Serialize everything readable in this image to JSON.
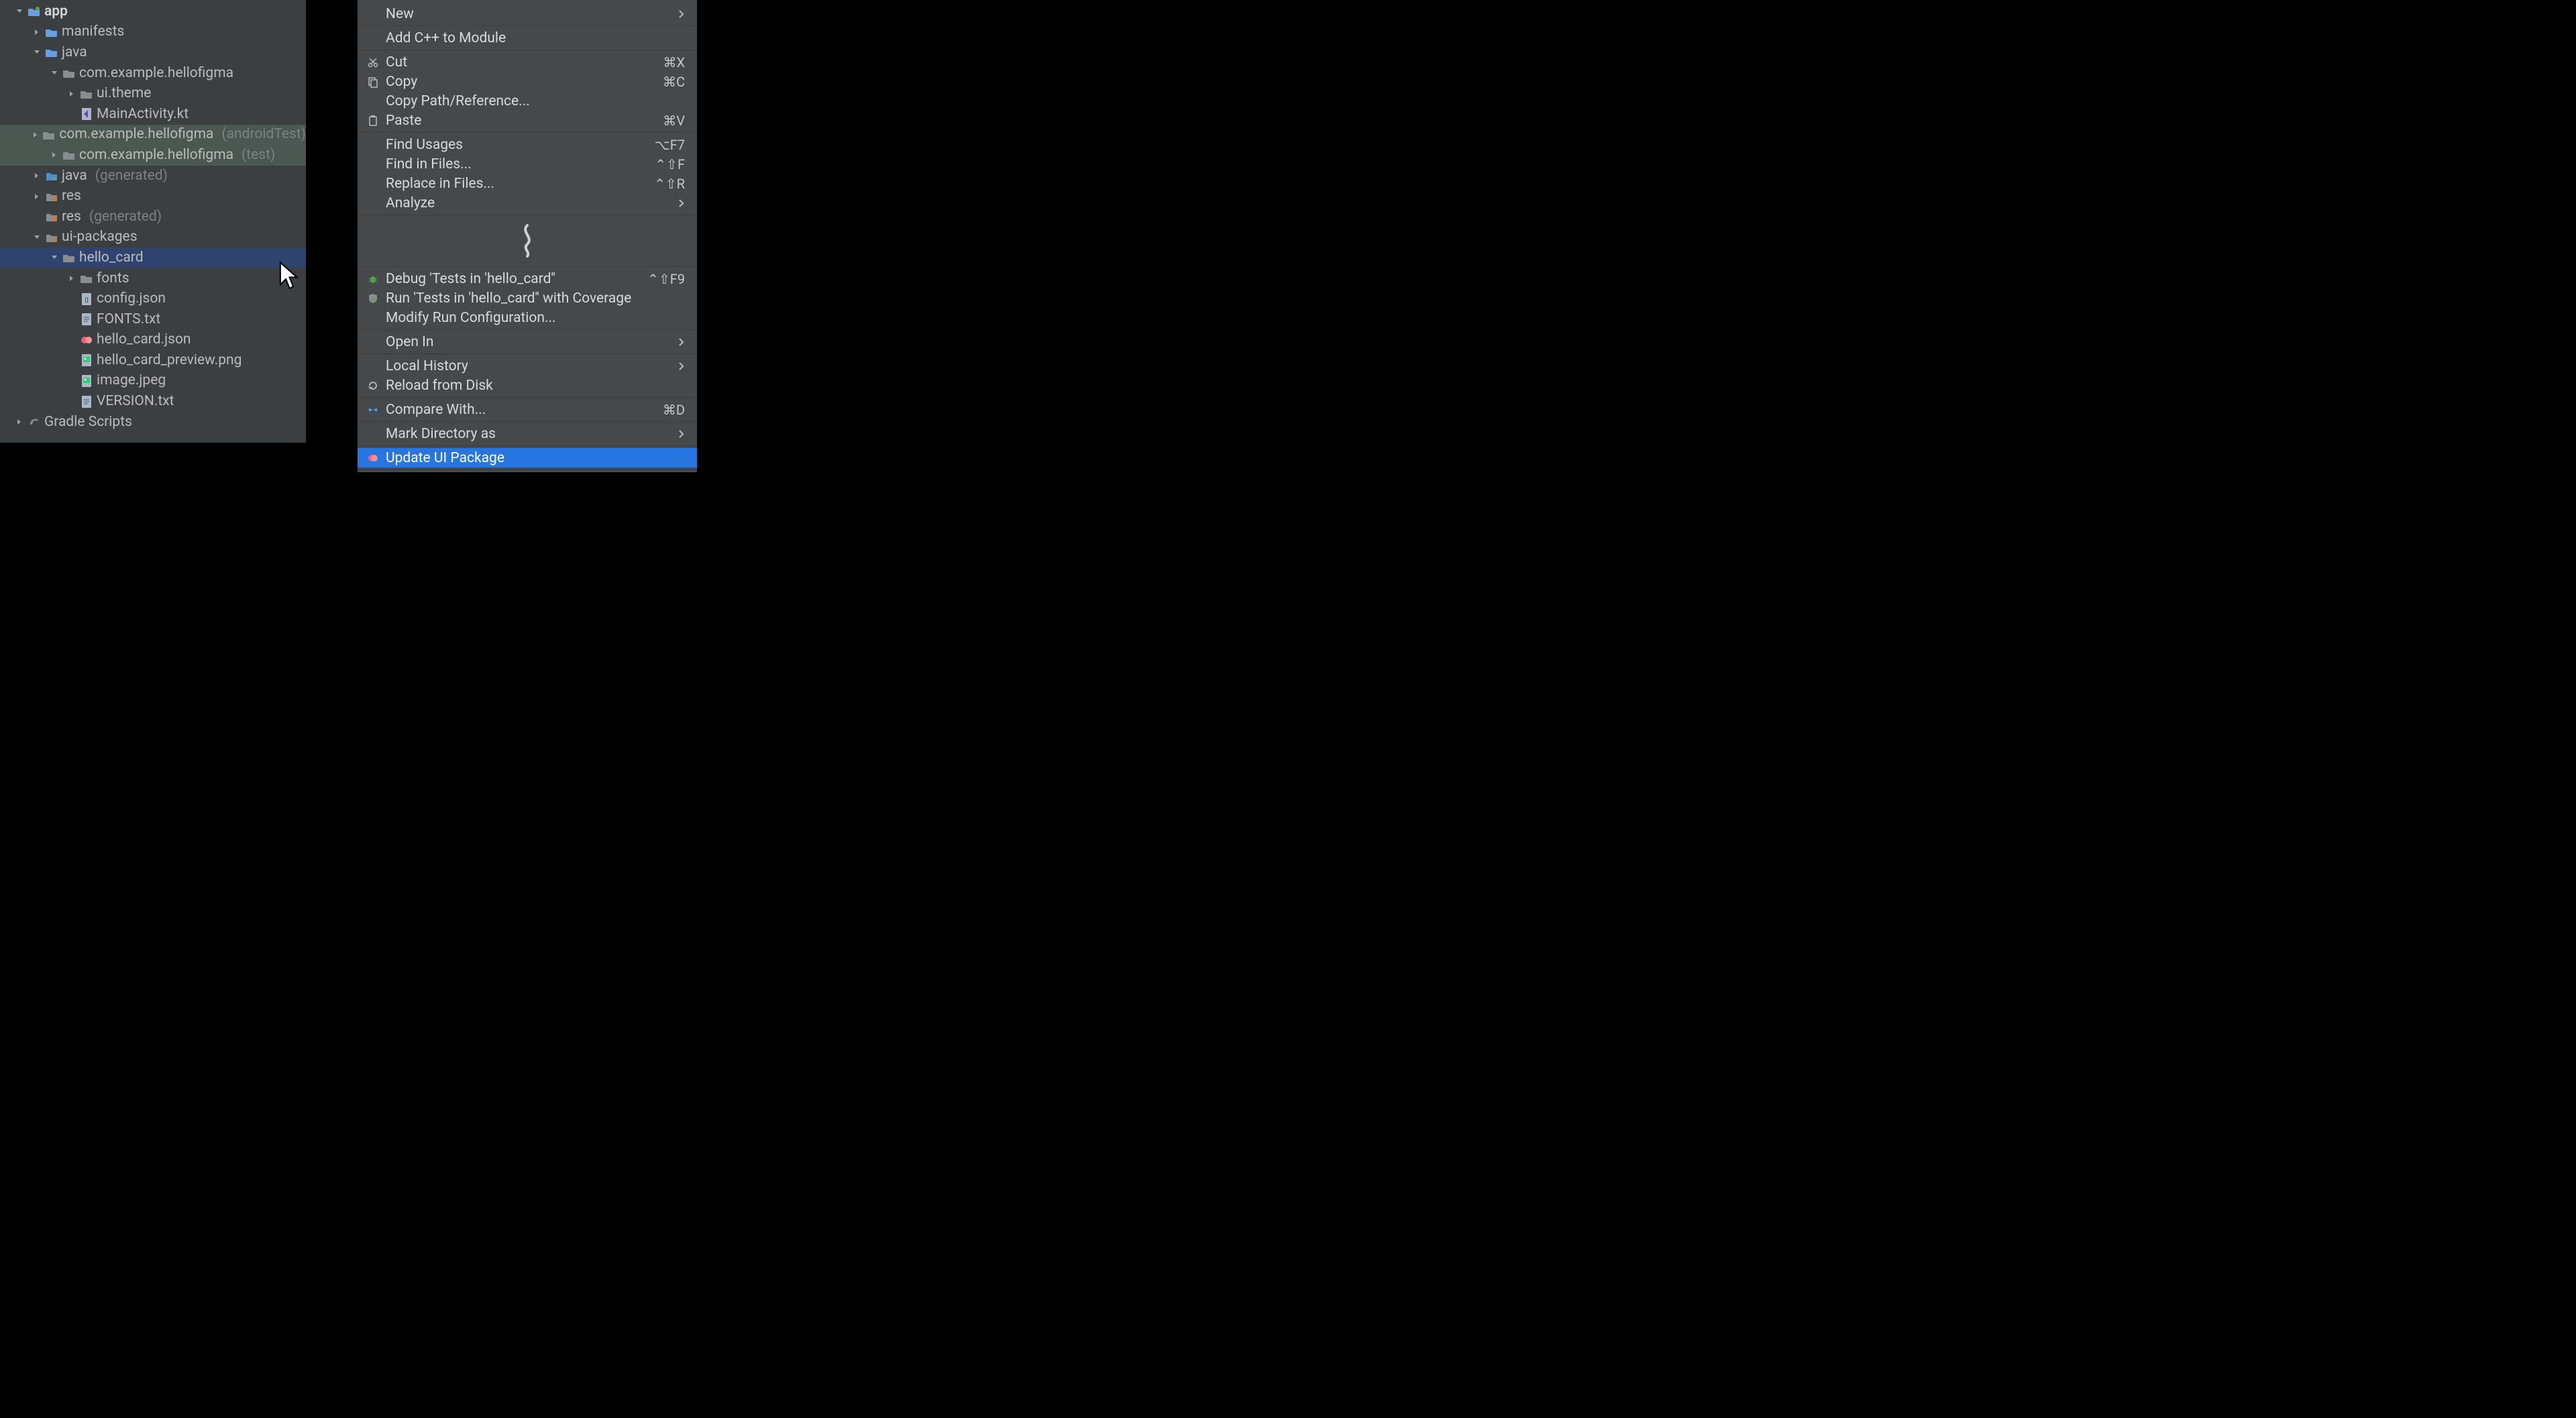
{
  "tree": {
    "rows": [
      {
        "indent": 16,
        "arrow": "down",
        "icon": "module-folder",
        "label": "app",
        "bold": true
      },
      {
        "indent": 42,
        "arrow": "right",
        "icon": "folder-blue",
        "label": "manifests"
      },
      {
        "indent": 42,
        "arrow": "down",
        "icon": "folder-blue",
        "label": "java"
      },
      {
        "indent": 68,
        "arrow": "down",
        "icon": "folder-grey",
        "label": "com.example.hellofigma"
      },
      {
        "indent": 94,
        "arrow": "right",
        "icon": "folder-grey",
        "label": "ui.theme"
      },
      {
        "indent": 94,
        "arrow": "blank",
        "icon": "kt-file",
        "label": "MainActivity.kt"
      },
      {
        "indent": 68,
        "arrow": "right",
        "icon": "folder-grey",
        "label": "com.example.hellofigma",
        "suffix": "(androidTest)",
        "highlight": true
      },
      {
        "indent": 68,
        "arrow": "right",
        "icon": "folder-grey",
        "label": "com.example.hellofigma",
        "suffix": "(test)",
        "highlight": true
      },
      {
        "indent": 42,
        "arrow": "right",
        "icon": "gen-folder",
        "label": "java",
        "suffix": "(generated)"
      },
      {
        "indent": 42,
        "arrow": "right",
        "icon": "res-folder",
        "label": "res"
      },
      {
        "indent": 42,
        "arrow": "blank",
        "icon": "res-folder",
        "label": "res",
        "suffix": "(generated)"
      },
      {
        "indent": 42,
        "arrow": "down",
        "icon": "res-folder",
        "label": "ui-packages"
      },
      {
        "indent": 68,
        "arrow": "down",
        "icon": "folder-grey",
        "label": "hello_card",
        "selected": true
      },
      {
        "indent": 94,
        "arrow": "right",
        "icon": "folder-grey",
        "label": "fonts"
      },
      {
        "indent": 94,
        "arrow": "blank",
        "icon": "json-file",
        "label": "config.json"
      },
      {
        "indent": 94,
        "arrow": "blank",
        "icon": "txt-file",
        "label": "FONTS.txt"
      },
      {
        "indent": 94,
        "arrow": "blank",
        "icon": "relay-file",
        "label": "hello_card.json"
      },
      {
        "indent": 94,
        "arrow": "blank",
        "icon": "img-file",
        "label": "hello_card_preview.png"
      },
      {
        "indent": 94,
        "arrow": "blank",
        "icon": "img-file",
        "label": "image.jpeg"
      },
      {
        "indent": 94,
        "arrow": "blank",
        "icon": "txt-file",
        "label": "VERSION.txt"
      },
      {
        "indent": 16,
        "arrow": "right",
        "icon": "gradle",
        "label": "Gradle Scripts"
      }
    ]
  },
  "ctx_menu": {
    "items": [
      {
        "type": "item",
        "label": "New",
        "submenu": true,
        "first": true
      },
      {
        "type": "sep"
      },
      {
        "type": "item",
        "label": "Add C++ to Module"
      },
      {
        "type": "sep"
      },
      {
        "type": "item",
        "label": "Cut",
        "shortcut": "⌘X",
        "icon": "cut"
      },
      {
        "type": "item",
        "label": "Copy",
        "shortcut": "⌘C",
        "icon": "copy"
      },
      {
        "type": "item",
        "label": "Copy Path/Reference..."
      },
      {
        "type": "item",
        "label": "Paste",
        "shortcut": "⌘V",
        "icon": "paste"
      },
      {
        "type": "sep"
      },
      {
        "type": "item",
        "label": "Find Usages",
        "shortcut": "⌥F7"
      },
      {
        "type": "item",
        "label": "Find in Files...",
        "shortcut": "⌃⇧F"
      },
      {
        "type": "item",
        "label": "Replace in Files...",
        "shortcut": "⌃⇧R"
      },
      {
        "type": "item",
        "label": "Analyze",
        "submenu": true
      },
      {
        "type": "sep"
      },
      {
        "type": "squiggle"
      },
      {
        "type": "sep"
      },
      {
        "type": "item",
        "label": "Debug 'Tests in 'hello_card''",
        "shortcut": "⌃⇧F9",
        "icon": "bug"
      },
      {
        "type": "item",
        "label": "Run 'Tests in 'hello_card'' with Coverage",
        "icon": "run-cov"
      },
      {
        "type": "item",
        "label": "Modify Run Configuration..."
      },
      {
        "type": "sep"
      },
      {
        "type": "item",
        "label": "Open In",
        "submenu": true
      },
      {
        "type": "sep"
      },
      {
        "type": "item",
        "label": "Local History",
        "submenu": true
      },
      {
        "type": "item",
        "label": "Reload from Disk",
        "icon": "reload"
      },
      {
        "type": "sep"
      },
      {
        "type": "item",
        "label": "Compare With...",
        "shortcut": "⌘D",
        "icon": "compare"
      },
      {
        "type": "sep"
      },
      {
        "type": "item",
        "label": "Mark Directory as",
        "submenu": true
      },
      {
        "type": "sep"
      },
      {
        "type": "item",
        "label": "Update UI Package",
        "icon": "relay-pink",
        "highlight": true
      },
      {
        "type": "sep"
      }
    ]
  }
}
